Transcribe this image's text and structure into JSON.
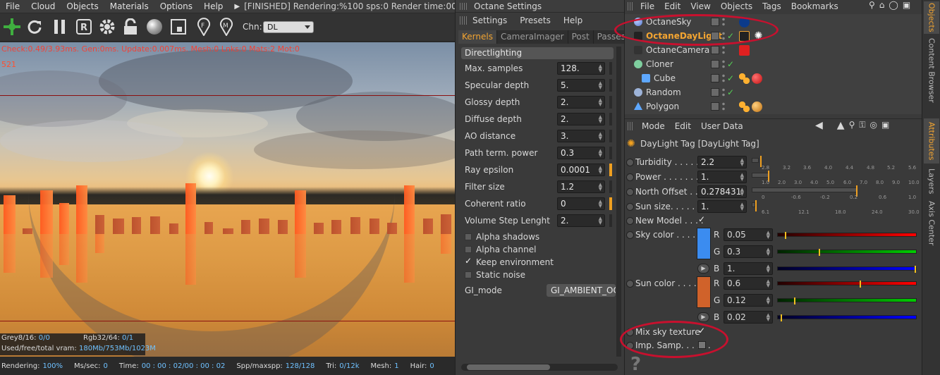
{
  "viewer": {
    "menu": [
      "File",
      "Cloud",
      "Objects",
      "Materials",
      "Options",
      "Help"
    ],
    "status_text": "[FINISHED]  Rendering:%100 sps:0 Render time:00 : 00 : 0",
    "toolbar_icons": [
      "octane-logo-icon",
      "refresh-icon",
      "pause-icon",
      "r-region-icon",
      "gear-icon",
      "lock-icon",
      "sphere-icon",
      "screenshot-icon",
      "f-pin-icon",
      "m-pin-icon"
    ],
    "channel_label": "Chn:",
    "channel_value": "DL",
    "debug_line1": "Check:0.49/3.93ms. Gen:0ms. Update:0.007ms. Mesh:0 Lnks:0 Mats:2 Mot:0",
    "debug_line2": "521",
    "info": {
      "grey_label": "Grey8/16:",
      "grey_value": "0/0",
      "rgb_label": "Rgb32/64:",
      "rgb_value": "0/1",
      "vram_label": "Used/free/total vram:",
      "vram_value": "180Mb/753Mb/1023M"
    },
    "status": {
      "rendering_label": "Rendering:",
      "rendering_value": "100%",
      "mssec_label": "Ms/sec:",
      "mssec_value": "0",
      "time_label": "Time:",
      "time_value": "00 : 00 : 02/00 : 00 : 02",
      "spp_label": "Spp/maxspp:",
      "spp_value": "128/128",
      "tri_label": "Tri:",
      "tri_value": "0/12k",
      "mesh_label": "Mesh:",
      "mesh_value": "1",
      "hair_label": "Hair:",
      "hair_value": "0"
    }
  },
  "settings": {
    "title": "Octane Settings",
    "menu": [
      "Settings",
      "Presets",
      "Help"
    ],
    "tabs": [
      "Kernels",
      "CameraImager",
      "Post",
      "Passes"
    ],
    "active_tab": "Kernels",
    "group": "Directlighting",
    "rows": [
      {
        "label": "Max. samples",
        "value": "128."
      },
      {
        "label": "Specular depth",
        "value": "5."
      },
      {
        "label": "Glossy depth",
        "value": "2."
      },
      {
        "label": "Diffuse depth",
        "value": "2."
      },
      {
        "label": "AO distance",
        "value": "3."
      },
      {
        "label": "Path term. power",
        "value": "0.3"
      },
      {
        "label": "Ray epsilon",
        "value": "0.0001"
      },
      {
        "label": "Filter size",
        "value": "1.2"
      },
      {
        "label": "Coherent ratio",
        "value": "0"
      },
      {
        "label": "Volume Step Lenght",
        "value": "2."
      }
    ],
    "checks": [
      {
        "label": "Alpha shadows",
        "checked": false
      },
      {
        "label": "Alpha channel",
        "checked": false
      },
      {
        "label": "Keep environment",
        "checked": true
      },
      {
        "label": "Static noise",
        "checked": false
      }
    ],
    "gi_mode_label": "GI_mode",
    "gi_mode_value": "GI_AMBIENT_OC"
  },
  "objects": {
    "menu": [
      "File",
      "Edit",
      "View",
      "Objects",
      "Tags",
      "Bookmarks"
    ],
    "items": [
      {
        "name": "OctaneSky",
        "highlight": false
      },
      {
        "name": "OctaneDayLight",
        "highlight": true
      },
      {
        "name": "OctaneCamera",
        "highlight": false
      },
      {
        "name": "Cloner",
        "highlight": false
      },
      {
        "name": "Cube",
        "highlight": false
      },
      {
        "name": "Random",
        "highlight": false
      },
      {
        "name": "Polygon",
        "highlight": false
      }
    ]
  },
  "side_tabs": [
    "Objects",
    "Content Browser",
    "Attributes",
    "Layers",
    "Axis Center"
  ],
  "attributes": {
    "menu": [
      "Mode",
      "Edit",
      "User Data"
    ],
    "title": "DayLight Tag [DayLight Tag]",
    "turbidity_label": "Turbidity . . . . . .",
    "turbidity_value": "2.2",
    "turbidity_ticks": [
      "2.8",
      "3.2",
      "3.6",
      "4.0",
      "4.4",
      "4.8",
      "5.2",
      "5.6"
    ],
    "turbidity_level": 0.05,
    "power_label": "Power . . . . . . . . .",
    "power_value": "1.",
    "power_ticks": [
      "1.0",
      "2.0",
      "3.0",
      "4.0",
      "5.0",
      "6.0",
      "7.0",
      "8.0",
      "9.0",
      "10.0"
    ],
    "power_level": 0.1,
    "north_label": "North Offset . . .",
    "north_value": "0.278431",
    "north_ticks": [
      "0",
      "-0.6",
      "-0.2",
      "0.2",
      "0.6",
      "1.0"
    ],
    "north_level": 0.64,
    "sunsize_label": "Sun size. . . . . . .",
    "sunsize_value": "1.",
    "sunsize_ticks": [
      "6.1",
      "12.1",
      "18.0",
      "24.0",
      "30.0"
    ],
    "sunsize_level": 0.02,
    "new_model_label": "New Model . . . .",
    "sky_color_label": "Sky color . . . . . .",
    "sky_r": "0.05",
    "sky_g": "0.3",
    "sky_b": "1.",
    "sky_swatch": "#3b8cf0",
    "sun_color_label": "Sun color . . . . .",
    "sun_r": "0.6",
    "sun_g": "0.12",
    "sun_b": "0.02",
    "sun_swatch": "#d0622a",
    "channel_r": "R",
    "channel_g": "G",
    "channel_b": "B",
    "mix_sky_label": "Mix sky texture",
    "imp_samp_label": "Imp. Samp. . . . . .",
    "help_symbol": "?"
  }
}
